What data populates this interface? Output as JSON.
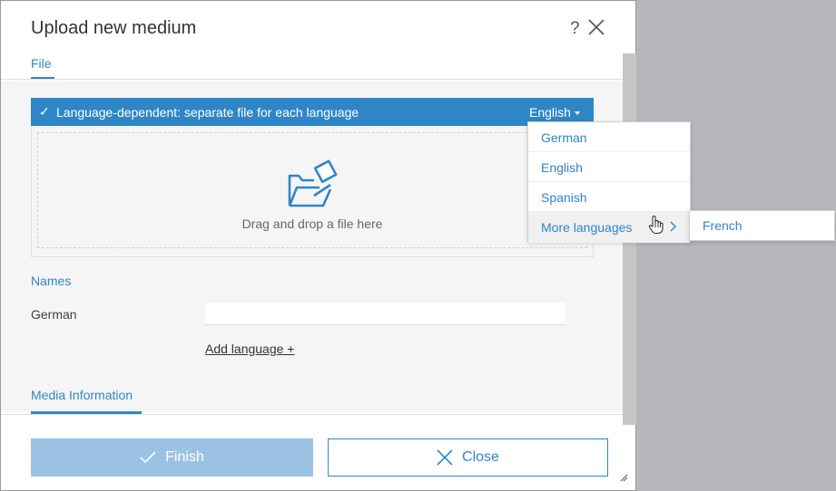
{
  "dialog": {
    "title": "Upload new medium",
    "help_icon": "?",
    "tab_file": "File"
  },
  "language_bar": {
    "check": "✓",
    "label": "Language-dependent: separate file for each language",
    "selected": "English"
  },
  "drop_zone": {
    "text": "Drag and drop a file here"
  },
  "names": {
    "title": "Names",
    "german_label": "German",
    "german_value": "",
    "add_language": "Add language +"
  },
  "media_information": {
    "title": "Media Information"
  },
  "buttons": {
    "finish": "Finish",
    "close": "Close"
  },
  "dropdown": {
    "items": [
      "German",
      "English",
      "Spanish"
    ],
    "more_languages": "More languages",
    "submenu_items": [
      "French"
    ]
  },
  "colors": {
    "accent": "#2f86c6",
    "finish_disabled": "#9cc2e3",
    "backdrop": "#b8b6bb"
  },
  "icons": {
    "help": "help-icon",
    "close": "close-icon",
    "check": "check-icon",
    "caret": "caret-down-icon",
    "folder": "folder-upload-icon",
    "chevron": "chevron-right-icon",
    "cursor": "hand-pointer-icon",
    "resize": "resize-grip-icon"
  }
}
